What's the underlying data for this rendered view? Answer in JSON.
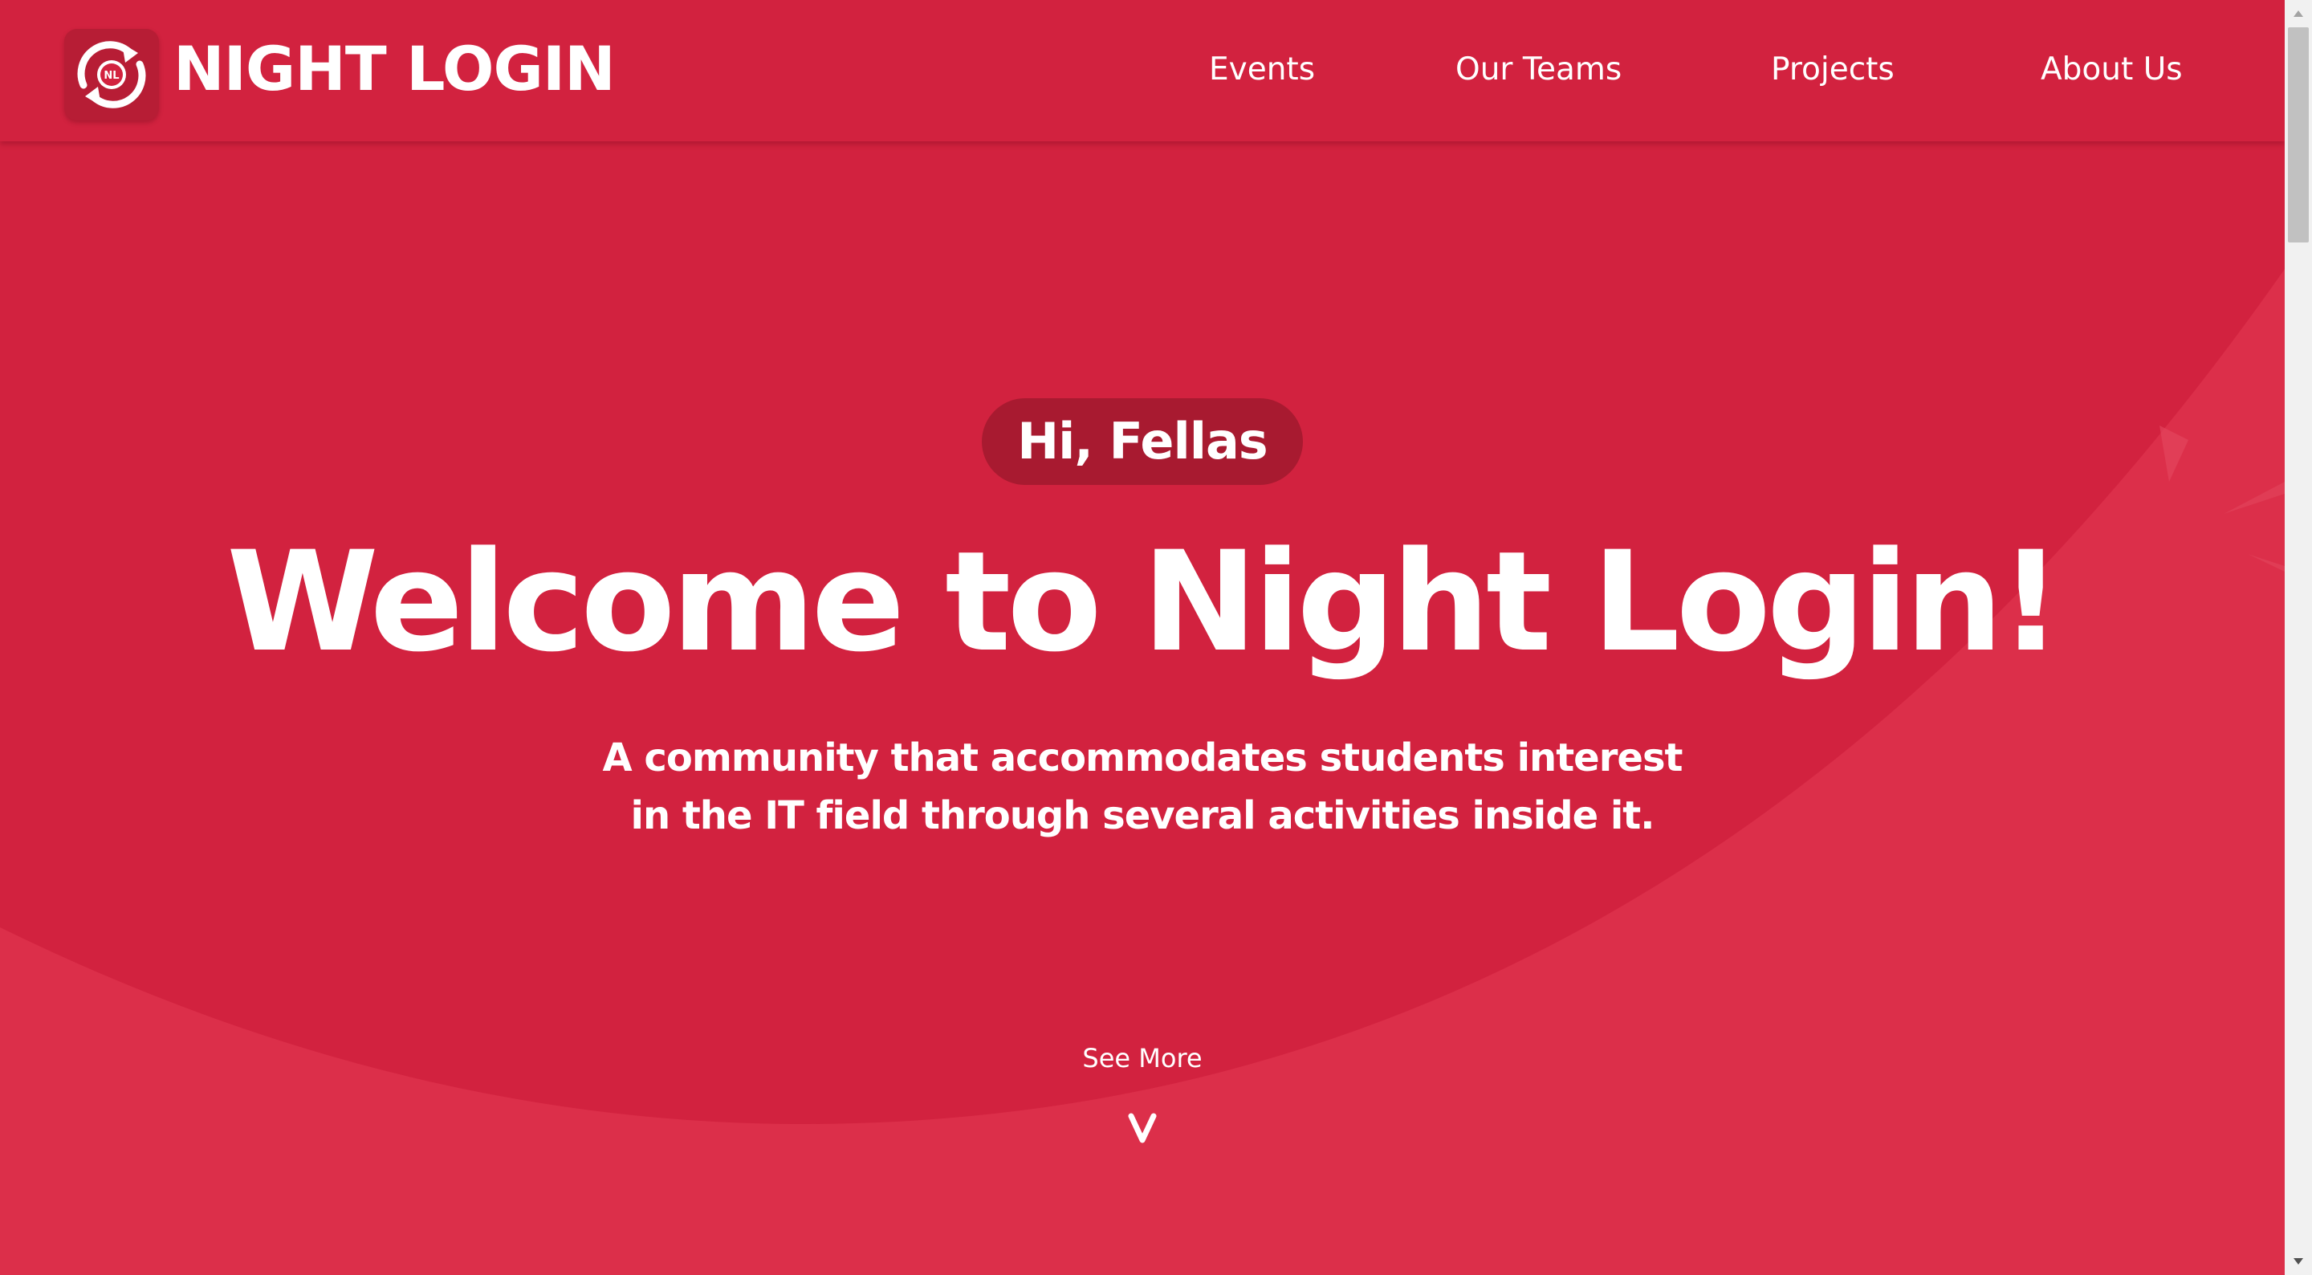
{
  "header": {
    "brand": "NIGHT LOGIN",
    "logo_text": "NL",
    "nav": [
      {
        "label": "Events"
      },
      {
        "label": "Our Teams"
      },
      {
        "label": "Projects"
      },
      {
        "label": "About Us"
      }
    ]
  },
  "hero": {
    "greeting": "Hi, Fellas",
    "title": "Welcome to Night Login!",
    "subtitle_lines": [
      "A community that accommodates students interest",
      "in the IT field through several activities inside it."
    ],
    "see_more": "See More",
    "chevron": "chevron-down-icon"
  },
  "colors": {
    "primary": "#d2223f",
    "secondary": "#dc2f4a",
    "pill": "#a81a30",
    "text": "#ffffff"
  }
}
